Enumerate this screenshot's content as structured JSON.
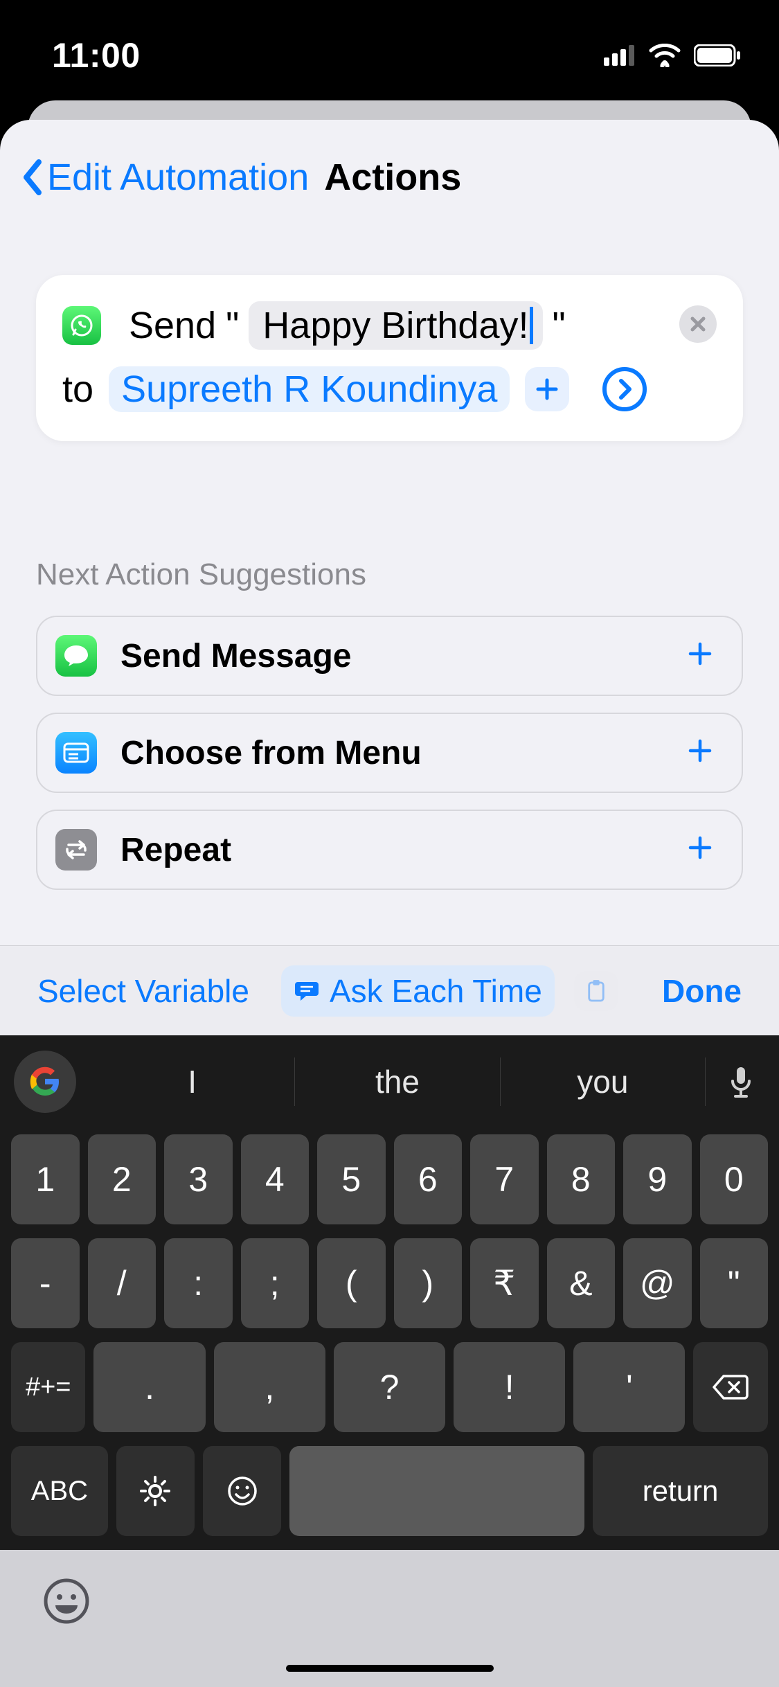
{
  "statusbar": {
    "time": "11:00"
  },
  "nav": {
    "back_label": "Edit Automation",
    "title": "Actions"
  },
  "action": {
    "prefix": "Send",
    "open_quote": "\"",
    "message": "Happy Birthday!",
    "close_quote": "\"",
    "to_label": "to",
    "recipient": "Supreeth R Koundinya"
  },
  "suggestions": {
    "header": "Next Action Suggestions",
    "items": [
      {
        "label": "Send Message",
        "icon": "messages",
        "color": "#34c759"
      },
      {
        "label": "Choose from Menu",
        "icon": "menu",
        "color": "#1fa7ff"
      },
      {
        "label": "Repeat",
        "icon": "repeat",
        "color": "#8e8e93"
      }
    ]
  },
  "varbar": {
    "select": "Select Variable",
    "ask": "Ask Each Time",
    "done": "Done"
  },
  "keyboard": {
    "suggestions": [
      "I",
      "the",
      "you"
    ],
    "row1": [
      "1",
      "2",
      "3",
      "4",
      "5",
      "6",
      "7",
      "8",
      "9",
      "0"
    ],
    "row2": [
      "-",
      "/",
      ":",
      ";",
      "(",
      ")",
      "₹",
      "&",
      "@",
      "\""
    ],
    "row3_sym": "#+=",
    "row3": [
      ".",
      ",",
      "?",
      "!",
      "'"
    ],
    "row4_abc": "ABC",
    "row4_return": "return"
  }
}
